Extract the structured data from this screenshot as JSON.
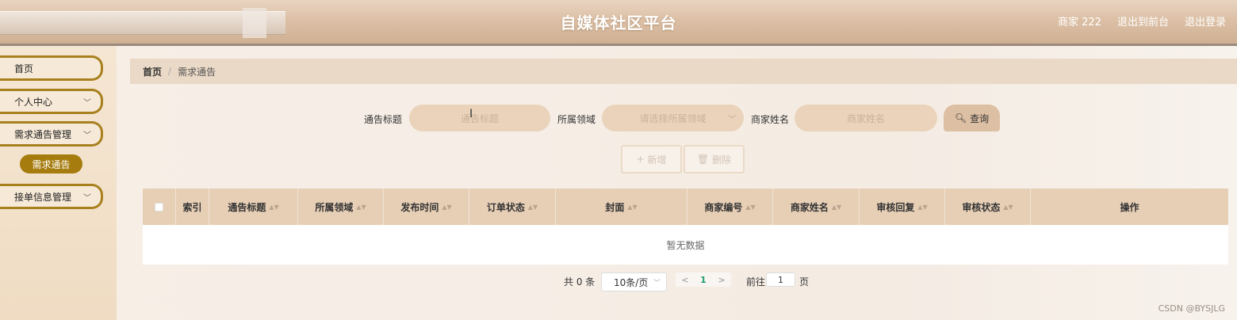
{
  "header": {
    "title": "自媒体社区平台",
    "user": "商家 222",
    "back_frontend": "退出到前台",
    "logout": "退出登录"
  },
  "sidebar": {
    "items": [
      {
        "label": "首页",
        "icon": ""
      },
      {
        "label": "个人中心",
        "icon": "chevron-down-icon"
      },
      {
        "label": "需求通告管理",
        "icon": "chevron-down-icon"
      },
      {
        "label": "接单信息管理",
        "icon": "chevron-down-icon"
      }
    ],
    "active_sub": "需求通告"
  },
  "breadcrumb": {
    "home": "首页",
    "separator": "/",
    "current": "需求通告"
  },
  "search": {
    "title_label": "通告标题",
    "title_placeholder": "通告标题",
    "domain_label": "所属领域",
    "domain_placeholder": "请选择所属领域",
    "merchant_label": "商家姓名",
    "merchant_placeholder": "商家姓名",
    "query_button": "查询"
  },
  "actions": {
    "add": "新增",
    "delete": "删除"
  },
  "table": {
    "columns": [
      "索引",
      "通告标题",
      "所属领域",
      "发布时间",
      "订单状态",
      "封面",
      "商家编号",
      "商家姓名",
      "审核回复",
      "审核状态",
      "操作"
    ],
    "empty_text": "暂无数据"
  },
  "pagination": {
    "total": "共 0 条",
    "page_size": "10条/页",
    "current_page": "1",
    "goto_label": "前往",
    "goto_value": "1",
    "goto_suffix": "页"
  },
  "watermark": "CSDN @BYSJLG",
  "colors": {
    "accent": "#a67c0e",
    "table_header": "#e7cfb6",
    "pill": "#ead3ba"
  }
}
